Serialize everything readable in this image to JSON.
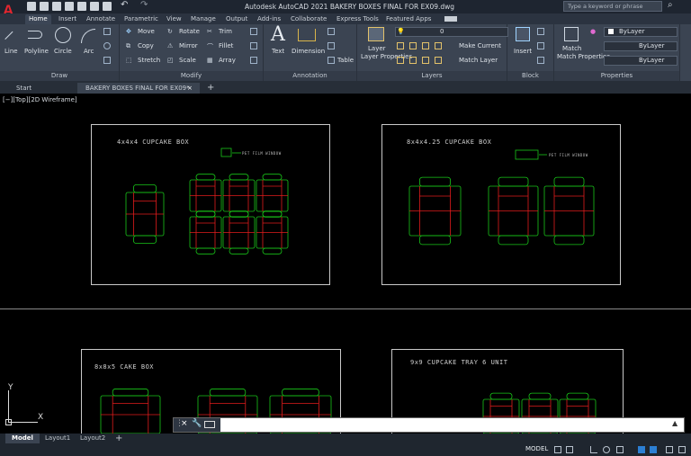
{
  "app": {
    "title": "Autodesk AutoCAD 2021    BAKERY BOXES FINAL FOR EX09.dwg",
    "search_placeholder": "Type a keyword or phrase",
    "logo": "A"
  },
  "menu": {
    "tabs": [
      "Home",
      "Insert",
      "Annotate",
      "Parametric",
      "View",
      "Manage",
      "Output",
      "Add-ins",
      "Collaborate",
      "Express Tools",
      "Featured Apps"
    ]
  },
  "ribbon": {
    "draw": {
      "title": "Draw",
      "line": "Line",
      "polyline": "Polyline",
      "circle": "Circle",
      "arc": "Arc"
    },
    "modify": {
      "title": "Modify",
      "move": "Move",
      "rotate": "Rotate",
      "trim": "Trim",
      "copy": "Copy",
      "mirror": "Mirror",
      "fillet": "Fillet",
      "stretch": "Stretch",
      "scale": "Scale",
      "array": "Array"
    },
    "annotation": {
      "title": "Annotation",
      "text": "Text",
      "dimension": "Dimension",
      "table": "Table"
    },
    "layers": {
      "title": "Layers",
      "layer_properties": "Layer Properties",
      "layer_value": "0",
      "make_current": "Make Current",
      "match_layer": "Match Layer"
    },
    "block": {
      "title": "Block",
      "insert": "Insert"
    },
    "properties": {
      "title": "Properties",
      "match_properties": "Match Properties",
      "color": "ByLayer",
      "linetype": "ByLayer",
      "lineweight": "ByLayer"
    }
  },
  "doctabs": {
    "start": "Start",
    "active": "BAKERY BOXES FINAL FOR EX09*"
  },
  "viewport": {
    "label": "[−][Top][2D Wireframe]"
  },
  "drawing": {
    "box1": {
      "title": "4x4x4 CUPCAKE BOX",
      "note": "PET FILM WINDOW"
    },
    "box2": {
      "title": "8x4x4.25 CUPCAKE BOX",
      "note": "PET FILM WINDOW"
    },
    "box3": {
      "title": "8x8x5 CAKE BOX"
    },
    "box4": {
      "title": "9x9 CUPCAKE TRAY 6 UNIT"
    },
    "ucs": {
      "x": "X",
      "y": "Y"
    }
  },
  "layouts": {
    "model": "Model",
    "layout1": "Layout1",
    "layout2": "Layout2"
  },
  "status": {
    "mode": "MODEL"
  },
  "colors": {
    "outline": "#19c619",
    "fold": "#e01c1c",
    "frame": "#c9c9c9"
  }
}
